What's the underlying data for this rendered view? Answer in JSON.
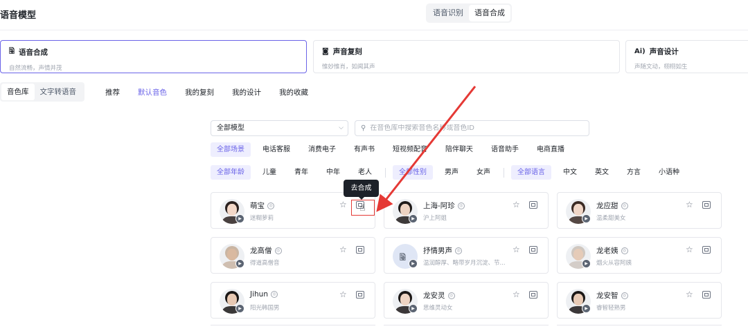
{
  "header": {
    "title": "语音模型",
    "mode_tabs": [
      {
        "label": "语音识别",
        "active": false
      },
      {
        "label": "语音合成",
        "active": true
      }
    ]
  },
  "features": [
    {
      "icon": "voice-synthesis-icon",
      "icon_text": "🗟",
      "title": "语音合成",
      "desc": "自然流畅，声情并茂",
      "active": true
    },
    {
      "icon": "voice-clone-icon",
      "icon_text": "◙",
      "title": "声音复刻",
      "desc": "惟妙惟肖，如闻其声",
      "active": false
    },
    {
      "icon": "ai-voice-design-icon",
      "icon_text": "Ai)",
      "title": "声音设计",
      "desc": "声随文动，栩栩如生",
      "active": false
    }
  ],
  "library_tabs": [
    {
      "label": "音色库",
      "active": true
    },
    {
      "label": "文字转语音",
      "active": false
    }
  ],
  "category_tabs": [
    {
      "label": "推荐",
      "active": false
    },
    {
      "label": "默认音色",
      "active": true
    },
    {
      "label": "我的复刻",
      "active": false
    },
    {
      "label": "我的设计",
      "active": false
    },
    {
      "label": "我的收藏",
      "active": false
    }
  ],
  "filters": {
    "model_select": "全部模型",
    "search_placeholder": "在音色库中搜索音色名称或音色ID",
    "scenes": [
      "全部场景",
      "电话客服",
      "消费电子",
      "有声书",
      "短视频配音",
      "陪伴聊天",
      "语音助手",
      "电商直播"
    ],
    "ages": [
      "全部年龄",
      "儿童",
      "青年",
      "中年",
      "老人"
    ],
    "genders": [
      "全部性别",
      "男声",
      "女声"
    ],
    "languages": [
      "全部语言",
      "中文",
      "英文",
      "方言",
      "小语种"
    ]
  },
  "tooltip": "去合成",
  "voices": [
    {
      "name": "萌宝",
      "desc": "迷糊萝莉",
      "avatar": "girl-avatar",
      "skin": "#f3d8c8",
      "hair": "#2b2220"
    },
    {
      "name": "上海-阿珍",
      "desc": "沪上阿姐",
      "avatar": "woman-avatar",
      "skin": "#edd3c2",
      "hair": "#1e1a19"
    },
    {
      "name": "龙应甜",
      "desc": "温柔甜美女",
      "avatar": "woman-avatar",
      "skin": "#f0d6c7",
      "hair": "#3a2a24"
    },
    {
      "name": "龙高僧",
      "desc": "得道高僧音",
      "avatar": "monk-avatar",
      "skin": "#d9b9a0",
      "hair": "#c9b5a3"
    },
    {
      "name": "抒情男声",
      "desc": "温润醇厚、略带岁月沉淀、节...",
      "avatar": "voice-icon-avatar",
      "skin": "#dfe6f5",
      "hair": "#dfe6f5"
    },
    {
      "name": "龙老姨",
      "desc": "烟火从容阿姨",
      "avatar": "elderly-woman-avatar",
      "skin": "#e5cbb8",
      "hair": "#cfc7c0"
    },
    {
      "name": "Jihun",
      "desc": "阳光韩国男",
      "avatar": "man-avatar",
      "skin": "#e8c9b3",
      "hair": "#1a1716"
    },
    {
      "name": "龙安灵",
      "desc": "思维灵动女",
      "avatar": "woman-avatar",
      "skin": "#efd4c3",
      "hair": "#1c1817"
    },
    {
      "name": "龙安智",
      "desc": "睿智轻熟男",
      "avatar": "man-avatar",
      "skin": "#e9cbb6",
      "hair": "#1c1817"
    }
  ]
}
